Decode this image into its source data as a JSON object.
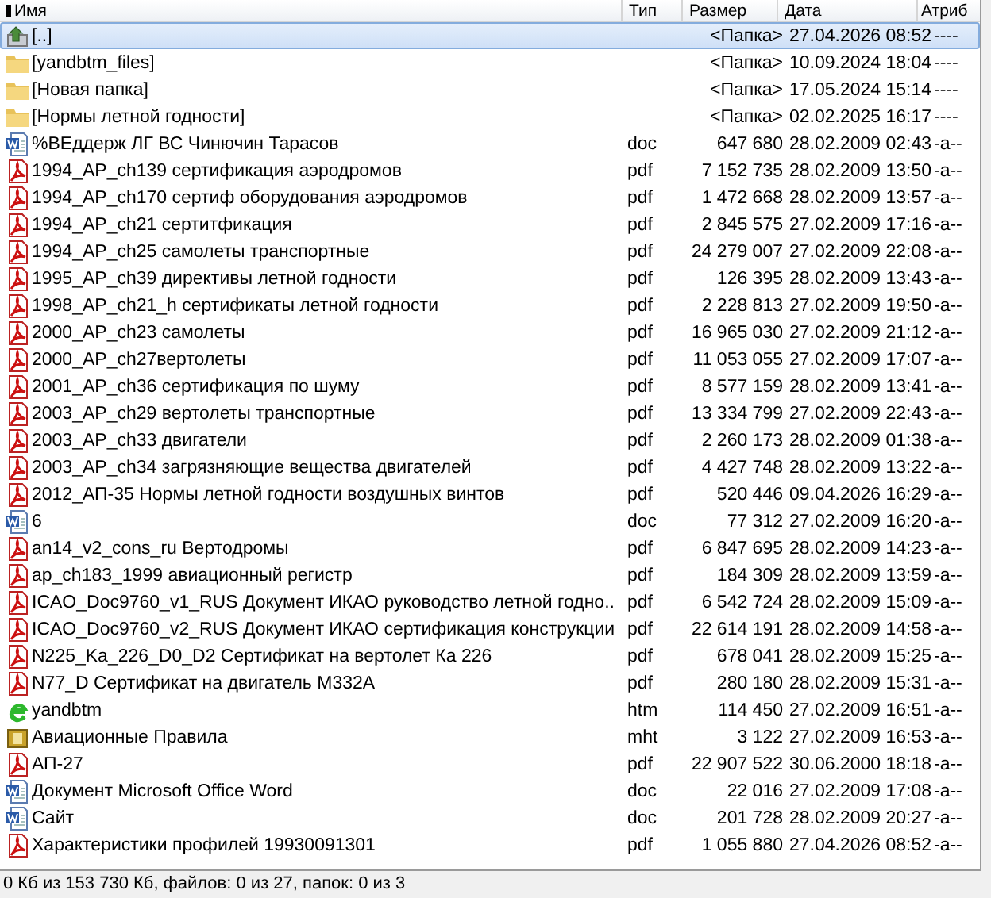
{
  "columns": [
    {
      "label": "Имя",
      "sorted": true
    },
    {
      "label": "Тип",
      "sorted": false
    },
    {
      "label": "Размер",
      "sorted": false
    },
    {
      "label": "Дата",
      "sorted": false
    },
    {
      "label": "Атриб",
      "sorted": false
    }
  ],
  "files": [
    {
      "kind": "up",
      "name": "[..]",
      "size": "<Папка>",
      "date": "27.04.2026 08:52",
      "attr": "----",
      "selected": true
    },
    {
      "kind": "folder",
      "name": "[yandbtm_files]",
      "size": "<Папка>",
      "date": "10.09.2024 18:04",
      "attr": "----",
      "selected": false
    },
    {
      "kind": "folder",
      "name": "[Новая папка]",
      "size": "<Папка>",
      "date": "17.05.2024 15:14",
      "attr": "----",
      "selected": false
    },
    {
      "kind": "folder",
      "name": "[Нормы летной годности]",
      "size": "<Папка>",
      "date": "02.02.2025 16:17",
      "attr": "----",
      "selected": false
    },
    {
      "kind": "doc",
      "name": "%BEддерж ЛГ ВС Чинючин Тарасов",
      "type": "doc",
      "size": "647 680",
      "date": "28.02.2009 02:43",
      "attr": "-a--",
      "selected": false
    },
    {
      "kind": "pdf",
      "name": "1994_AP_ch139 сертификация аэродромов",
      "type": "pdf",
      "size": "7 152 735",
      "date": "28.02.2009 13:50",
      "attr": "-a--",
      "selected": false
    },
    {
      "kind": "pdf",
      "name": "1994_AP_ch170 сертиф оборудования аэродромов",
      "type": "pdf",
      "size": "1 472 668",
      "date": "28.02.2009 13:57",
      "attr": "-a--",
      "selected": false
    },
    {
      "kind": "pdf",
      "name": "1994_AP_ch21 сертитфикация",
      "type": "pdf",
      "size": "2 845 575",
      "date": "27.02.2009 17:16",
      "attr": "-a--",
      "selected": false
    },
    {
      "kind": "pdf",
      "name": "1994_AP_ch25 самолеты транспортные",
      "type": "pdf",
      "size": "24 279 007",
      "date": "27.02.2009 22:08",
      "attr": "-a--",
      "selected": false
    },
    {
      "kind": "pdf",
      "name": "1995_AP_ch39 директивы летной годности",
      "type": "pdf",
      "size": "126 395",
      "date": "28.02.2009 13:43",
      "attr": "-a--",
      "selected": false
    },
    {
      "kind": "pdf",
      "name": "1998_AP_ch21_h сертификаты летной годности",
      "type": "pdf",
      "size": "2 228 813",
      "date": "27.02.2009 19:50",
      "attr": "-a--",
      "selected": false
    },
    {
      "kind": "pdf",
      "name": "2000_AP_ch23 самолеты",
      "type": "pdf",
      "size": "16 965 030",
      "date": "27.02.2009 21:12",
      "attr": "-a--",
      "selected": false
    },
    {
      "kind": "pdf",
      "name": "2000_AP_ch27вертолеты",
      "type": "pdf",
      "size": "11 053 055",
      "date": "27.02.2009 17:07",
      "attr": "-a--",
      "selected": false
    },
    {
      "kind": "pdf",
      "name": "2001_AP_ch36 сертификация по шуму",
      "type": "pdf",
      "size": "8 577 159",
      "date": "28.02.2009 13:41",
      "attr": "-a--",
      "selected": false
    },
    {
      "kind": "pdf",
      "name": "2003_AP_ch29 вертолеты транспортные",
      "type": "pdf",
      "size": "13 334 799",
      "date": "27.02.2009 22:43",
      "attr": "-a--",
      "selected": false
    },
    {
      "kind": "pdf",
      "name": "2003_AP_ch33 двигатели",
      "type": "pdf",
      "size": "2 260 173",
      "date": "28.02.2009 01:38",
      "attr": "-a--",
      "selected": false
    },
    {
      "kind": "pdf",
      "name": "2003_AP_ch34 загрязняющие вещества двигателей",
      "type": "pdf",
      "size": "4 427 748",
      "date": "28.02.2009 13:22",
      "attr": "-a--",
      "selected": false
    },
    {
      "kind": "pdf",
      "name": "2012_АП-35 Нормы летной годности воздушных винтов",
      "type": "pdf",
      "size": "520 446",
      "date": "09.04.2026 16:29",
      "attr": "-a--",
      "selected": false
    },
    {
      "kind": "doc",
      "name": "6",
      "type": "doc",
      "size": "77 312",
      "date": "27.02.2009 16:20",
      "attr": "-a--",
      "selected": false
    },
    {
      "kind": "pdf",
      "name": "an14_v2_cons_ru Вертодромы",
      "type": "pdf",
      "size": "6 847 695",
      "date": "28.02.2009 14:23",
      "attr": "-a--",
      "selected": false
    },
    {
      "kind": "pdf",
      "name": "ap_ch183_1999 авиационный регистр",
      "type": "pdf",
      "size": "184 309",
      "date": "28.02.2009 13:59",
      "attr": "-a--",
      "selected": false
    },
    {
      "kind": "pdf",
      "name": "ICAO_Doc9760_v1_RUS Документ ИКАО руководство летной годно..",
      "type": "pdf",
      "size": "6 542 724",
      "date": "28.02.2009 15:09",
      "attr": "-a--",
      "selected": false
    },
    {
      "kind": "pdf",
      "name": "ICAO_Doc9760_v2_RUS Документ ИКАО сертификация конструкции",
      "type": "pdf",
      "size": "22 614 191",
      "date": "28.02.2009 14:58",
      "attr": "-a--",
      "selected": false
    },
    {
      "kind": "pdf",
      "name": "N225_Ka_226_D0_D2 Сертификат на вертолет Ка 226",
      "type": "pdf",
      "size": "678 041",
      "date": "28.02.2009 15:25",
      "attr": "-a--",
      "selected": false
    },
    {
      "kind": "pdf",
      "name": "N77_D Сертификат на двигатель М332А",
      "type": "pdf",
      "size": "280 180",
      "date": "28.02.2009 15:31",
      "attr": "-a--",
      "selected": false
    },
    {
      "kind": "htm",
      "name": "yandbtm",
      "type": "htm",
      "size": "114 450",
      "date": "27.02.2009 16:51",
      "attr": "-a--",
      "selected": false
    },
    {
      "kind": "mht",
      "name": "Авиационные Правила",
      "type": "mht",
      "size": "3 122",
      "date": "27.02.2009 16:53",
      "attr": "-a--",
      "selected": false
    },
    {
      "kind": "pdf",
      "name": "АП-27",
      "type": "pdf",
      "size": "22 907 522",
      "date": "30.06.2000 18:18",
      "attr": "-a--",
      "selected": false
    },
    {
      "kind": "doc",
      "name": "Документ Microsoft Office Word",
      "type": "doc",
      "size": "22 016",
      "date": "27.02.2009 17:08",
      "attr": "-a--",
      "selected": false
    },
    {
      "kind": "doc",
      "name": "Сайт",
      "type": "doc",
      "size": "201 728",
      "date": "28.02.2009 20:27",
      "attr": "-a--",
      "selected": false
    },
    {
      "kind": "pdf",
      "name": "Характеристики профилей 19930091301",
      "type": "pdf",
      "size": "1 055 880",
      "date": "27.04.2026 08:52",
      "attr": "-a--",
      "selected": false
    }
  ],
  "status_bar": "0 Кб из 153 730 Кб, файлов: 0 из 27, папок: 0 из 3"
}
